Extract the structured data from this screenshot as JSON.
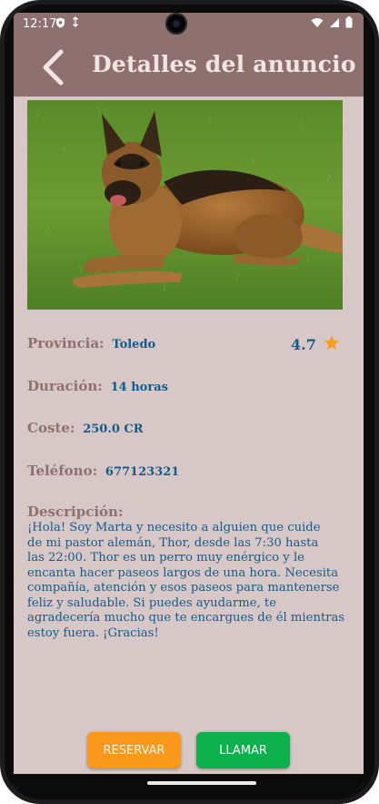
{
  "status_bar": {
    "time": "12:17"
  },
  "app_bar": {
    "title": "Detalles del anuncio"
  },
  "listing": {
    "photo_alt": "Pastor alemán",
    "province": {
      "label": "Provincia:",
      "value": "Toledo"
    },
    "rating": {
      "value": "4.7",
      "color": "#f99b1c"
    },
    "duration": {
      "label": "Duración:",
      "value": "14 horas"
    },
    "cost": {
      "label": "Coste:",
      "value": "250.0 CR"
    },
    "phone": {
      "label": "Teléfono:",
      "value": "677123321"
    },
    "description": {
      "label": "Descripción:",
      "lines": [
        "¡Hola! Soy Marta y necesito a alguien que cuide",
        "de mi pastor alemán, Thor, desde las 7:30 hasta",
        "las 22:00. Thor es un perro muy enérgico y le",
        "encanta hacer paseos largos de una hora. Necesita",
        "compañía, atención y esos paseos para mantenerse",
        "feliz y saludable. Si puedes ayudarme, te",
        "agradecería mucho que te encargues de él mientras",
        "estoy fuera. ¡Gracias!"
      ]
    }
  },
  "actions": {
    "reserve": {
      "label": "RESERVAR",
      "color": "#f9981b"
    },
    "call": {
      "label": "LLAMAR",
      "color": "#0db14b"
    }
  },
  "theme": {
    "header": "#8e706f",
    "background": "#d7c8c7",
    "value_text": "#145b8a"
  }
}
